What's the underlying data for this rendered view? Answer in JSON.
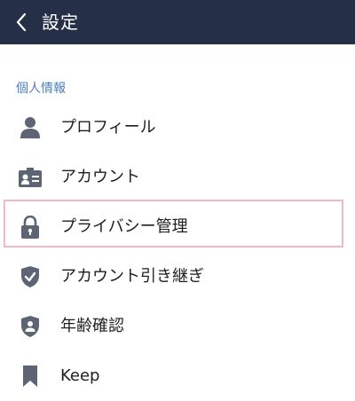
{
  "header": {
    "title": "設定",
    "background": "#253048"
  },
  "section": {
    "label": "個人情報",
    "label_color": "#4a7fc0"
  },
  "items": [
    {
      "label": "プロフィール",
      "icon": "person-icon"
    },
    {
      "label": "アカウント",
      "icon": "id-card-icon"
    },
    {
      "label": "プライバシー管理",
      "icon": "lock-icon",
      "highlighted": true
    },
    {
      "label": "アカウント引き継ぎ",
      "icon": "shield-check-icon"
    },
    {
      "label": "年齢確認",
      "icon": "shield-person-icon"
    },
    {
      "label": "Keep",
      "icon": "bookmark-icon"
    }
  ],
  "colors": {
    "icon": "#5d6474",
    "highlight_border": "#f0b8cf"
  }
}
